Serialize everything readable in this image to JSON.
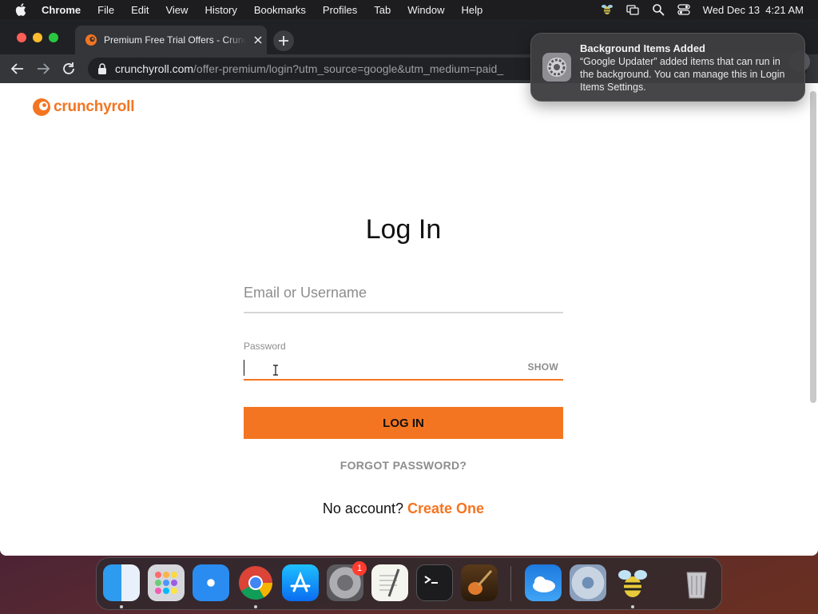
{
  "menubar": {
    "app_name": "Chrome",
    "menus": [
      "File",
      "Edit",
      "View",
      "History",
      "Bookmarks",
      "Profiles",
      "Tab",
      "Window",
      "Help"
    ],
    "clock": "Wed Dec 13  4:21 AM"
  },
  "browser": {
    "tab_title": "Premium Free Trial Offers - Crunchyroll",
    "url_host": "crunchyroll.com",
    "url_path": "/offer-premium/login?utm_source=google&utm_medium=paid_"
  },
  "page": {
    "logo_text": "crunchyroll",
    "title": "Log In",
    "email_placeholder": "Email or Username",
    "password_label": "Password",
    "show_label": "SHOW",
    "login_button": "LOG IN",
    "forgot_password": "FORGOT PASSWORD?",
    "no_account": "No account?",
    "create_one": "Create One"
  },
  "notification": {
    "title": "Background Items Added",
    "body": "“Google Updater” added items that can run in the background. You can manage this in Login Items Settings."
  },
  "dock": {
    "apps": [
      "finder-icon",
      "launchpad-icon",
      "safari-icon",
      "chrome-icon",
      "app-store-icon",
      "system-preferences-icon",
      "textedit-icon",
      "terminal-icon",
      "garageband-icon",
      "weather-icon",
      "settings-icon",
      "bee-icon",
      "trash-icon"
    ],
    "badge": "1"
  },
  "colors": {
    "brand": "#f47521",
    "menubar": "#1d1d1f",
    "tabbar": "#202124"
  }
}
